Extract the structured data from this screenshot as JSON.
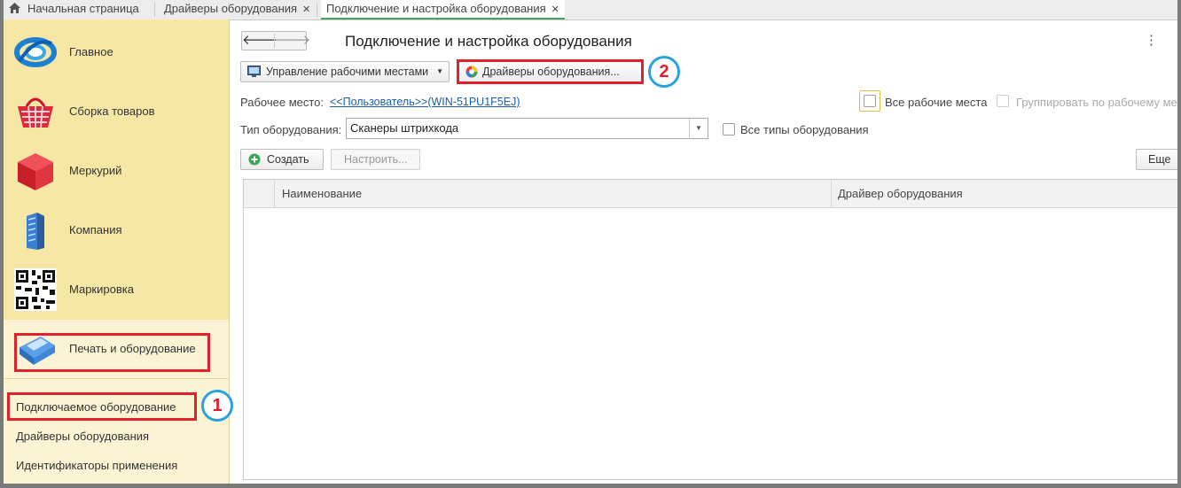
{
  "tabs": [
    {
      "label": "Начальная страница",
      "icon": "home-icon"
    },
    {
      "label": "Драйверы оборудования",
      "closable": true
    },
    {
      "label": "Подключение и настройка оборудования",
      "closable": true,
      "active": true
    }
  ],
  "tab_close_glyph": "✕",
  "sidebar": {
    "items": [
      {
        "label": "Главное",
        "icon": "globe-logo-icon"
      },
      {
        "label": "Сборка товаров",
        "icon": "shopping-basket-icon"
      },
      {
        "label": "Меркурий",
        "icon": "red-cube-icon"
      },
      {
        "label": "Компания",
        "icon": "office-building-icon"
      },
      {
        "label": "Маркировка",
        "icon": "qr-code-icon"
      },
      {
        "label": "Печать и оборудование",
        "icon": "payment-terminal-icon",
        "selected": true
      }
    ],
    "sub_items": [
      {
        "label": "Подключаемое оборудование"
      },
      {
        "label": "Драйверы оборудования"
      },
      {
        "label": "Идентификаторы применения"
      }
    ]
  },
  "annotations": {
    "badge1": "1",
    "badge2": "2",
    "highlight_color": "#e0202a",
    "badge_ring_color": "#29a3e0"
  },
  "main": {
    "back_glyph": "🡐",
    "forward_glyph": "🡒",
    "title": "Подключение и настройка оборудования",
    "more_glyph": "⋮",
    "toolbar": {
      "workplaces_button": "Управление рабочими местами",
      "drivers_button": "Драйверы оборудования..."
    },
    "workplace": {
      "label": "Рабочее место:",
      "value": "<<Пользователь>>(WIN-51PU1F5EJ)",
      "all_workplaces": "Все рабочие места",
      "group_by_workplace": "Группировать по рабочему мес"
    },
    "equipment_type": {
      "label": "Тип оборудования:",
      "value": "Сканеры штрихкода",
      "all_types": "Все типы оборудования"
    },
    "actions": {
      "create": "Создать",
      "configure": "Настроить...",
      "more": "Еще"
    },
    "table": {
      "columns": [
        "Наименование",
        "Драйвер оборудования"
      ],
      "rows": []
    }
  }
}
